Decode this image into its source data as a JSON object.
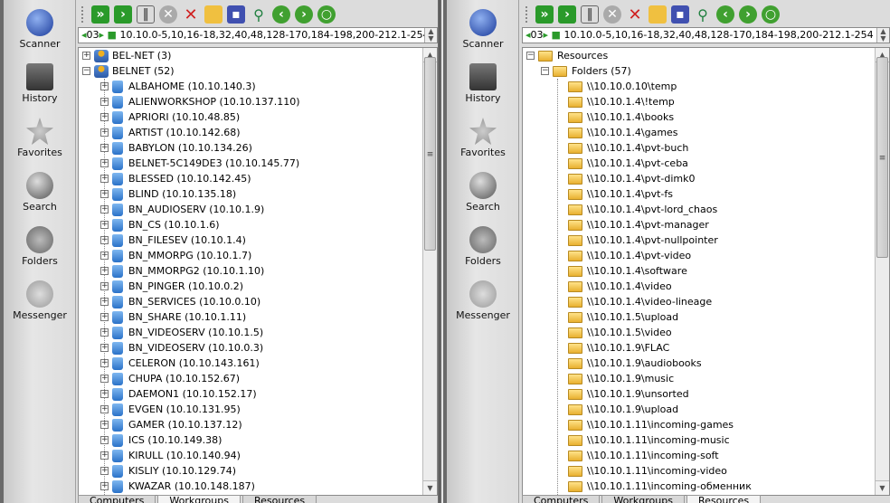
{
  "sidebar": {
    "items": [
      {
        "label": "Scanner"
      },
      {
        "label": "History"
      },
      {
        "label": "Favorites"
      },
      {
        "label": "Search"
      },
      {
        "label": "Folders"
      },
      {
        "label": "Messenger"
      }
    ]
  },
  "address": {
    "counter": "03",
    "ranges": "10.10.0-5,10,16-18,32,40,48,128-170,184-198,200-212.1-254"
  },
  "tabs": [
    "Computers",
    "Workgroups",
    "Resources"
  ],
  "left": {
    "groups": [
      {
        "label": "BEL-NET (3)"
      },
      {
        "label": "BELNET (52)"
      }
    ],
    "computers": [
      "ALBAHOME  (10.10.140.3)",
      "ALIENWORKSHOP  (10.10.137.110)",
      "APRIORI  (10.10.48.85)",
      "ARTIST  (10.10.142.68)",
      "BABYLON  (10.10.134.26)",
      "BELNET-5C149DE3  (10.10.145.77)",
      "BLESSED  (10.10.142.45)",
      "BLIND  (10.10.135.18)",
      "BN_AUDIOSERV  (10.10.1.9)",
      "BN_CS  (10.10.1.6)",
      "BN_FILESEV  (10.10.1.4)",
      "BN_MMORPG  (10.10.1.7)",
      "BN_MMORPG2  (10.10.1.10)",
      "BN_PINGER  (10.10.0.2)",
      "BN_SERVICES  (10.10.0.10)",
      "BN_SHARE  (10.10.1.11)",
      "BN_VIDEOSERV  (10.10.1.5)",
      "BN_VIDEOSERV  (10.10.0.3)",
      "CELERON  (10.10.143.161)",
      "CHUPA  (10.10.152.67)",
      "DAEMON1  (10.10.152.17)",
      "EVGEN  (10.10.131.95)",
      "GAMER  (10.10.137.12)",
      "ICS  (10.10.149.38)",
      "KIRULL  (10.10.140.94)",
      "KISLIY  (10.10.129.74)",
      "KWAZAR  (10.10.148.187)"
    ]
  },
  "right": {
    "root": "Resources",
    "folders_label": "Folders (57)",
    "folders": [
      "\\\\10.10.0.10\\temp",
      "\\\\10.10.1.4\\!temp",
      "\\\\10.10.1.4\\books",
      "\\\\10.10.1.4\\games",
      "\\\\10.10.1.4\\pvt-buch",
      "\\\\10.10.1.4\\pvt-ceba",
      "\\\\10.10.1.4\\pvt-dimk0",
      "\\\\10.10.1.4\\pvt-fs",
      "\\\\10.10.1.4\\pvt-lord_chaos",
      "\\\\10.10.1.4\\pvt-manager",
      "\\\\10.10.1.4\\pvt-nullpointer",
      "\\\\10.10.1.4\\pvt-video",
      "\\\\10.10.1.4\\software",
      "\\\\10.10.1.4\\video",
      "\\\\10.10.1.4\\video-lineage",
      "\\\\10.10.1.5\\upload",
      "\\\\10.10.1.5\\video",
      "\\\\10.10.1.9\\FLAC",
      "\\\\10.10.1.9\\audiobooks",
      "\\\\10.10.1.9\\music",
      "\\\\10.10.1.9\\unsorted",
      "\\\\10.10.1.9\\upload",
      "\\\\10.10.1.11\\incoming-games",
      "\\\\10.10.1.11\\incoming-music",
      "\\\\10.10.1.11\\incoming-soft",
      "\\\\10.10.1.11\\incoming-video",
      "\\\\10.10.1.11\\incoming-обменник"
    ]
  }
}
